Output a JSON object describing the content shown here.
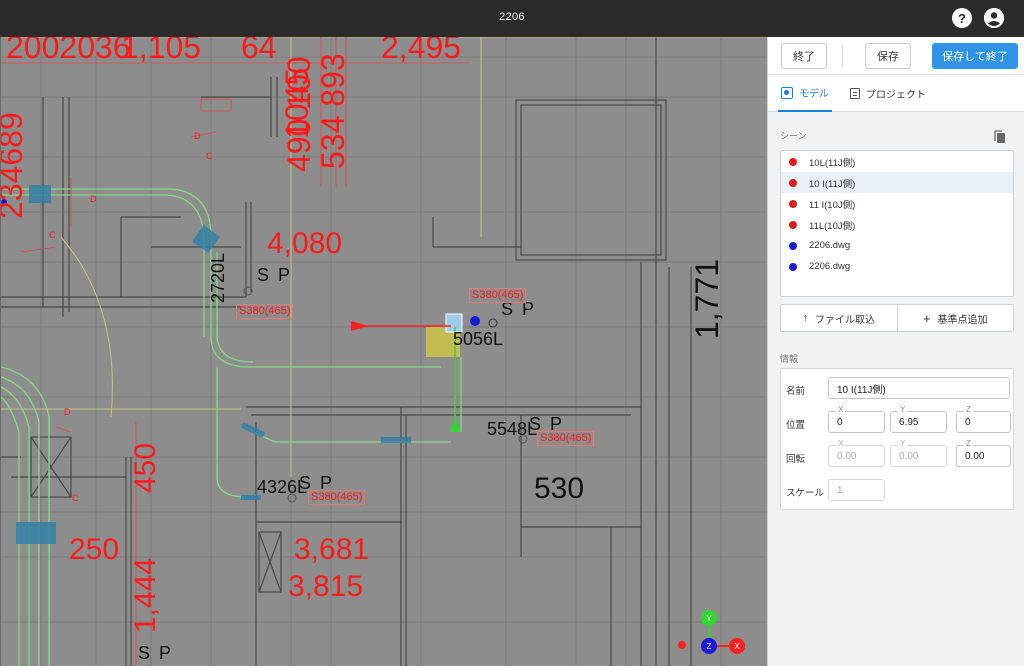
{
  "window": {
    "title": "2206"
  },
  "header": {
    "help_icon": "help-circle-icon",
    "account_icon": "account-circle-icon"
  },
  "toolbar": {
    "exit_label": "終了",
    "save_label": "保存",
    "save_exit_label": "保存して終了"
  },
  "tabs": [
    {
      "label": "モデル",
      "icon": "model-icon",
      "active": true
    },
    {
      "label": "プロジェクト",
      "icon": "document-icon",
      "active": false
    }
  ],
  "scene": {
    "label": "シーン",
    "copy_icon": "copy-icon",
    "items": [
      {
        "label": "10L(11J側)",
        "color": "#e01b1b",
        "selected": false
      },
      {
        "label": "10 I(11J側)",
        "color": "#e01b1b",
        "selected": true
      },
      {
        "label": "11 I(10J側)",
        "color": "#e01b1b",
        "selected": false
      },
      {
        "label": "11L(10J側)",
        "color": "#e01b1b",
        "selected": false
      },
      {
        "label": "2206.dwg",
        "color": "#1a1ad8",
        "selected": false
      },
      {
        "label": "2206.dwg",
        "color": "#1a1ad8",
        "selected": false
      }
    ]
  },
  "actions": {
    "import_label": "ファイル取込",
    "add_ref_label": "基準点追加"
  },
  "info": {
    "label": "情報",
    "name_label": "名前",
    "name_value": "10 I(11J側)",
    "position_label": "位置",
    "position": {
      "x": "0",
      "y": "6.95",
      "z": "0"
    },
    "rotation_label": "回転",
    "rotation": {
      "x": "0.00",
      "y": "0.00",
      "z": "0.00"
    },
    "scale_label": "スケール",
    "scale_value": "1",
    "axis": {
      "x": "X",
      "y": "Y",
      "z": "Z"
    }
  },
  "viewport": {
    "dimensions": [
      "2002036",
      "1,105",
      "64",
      "2,495",
      "1045",
      "490 100",
      "534 893",
      "234689",
      "4,080",
      "1,771",
      "450",
      "250",
      "530",
      "1,444",
      "3,681",
      "3,815"
    ],
    "labels": [
      "2720L",
      "S P",
      "5056L",
      "5548L",
      "4326L",
      "S P",
      "S P",
      "S P",
      "S P"
    ],
    "tags": [
      "S380(465)",
      "S380(465)",
      "S380(465)",
      "S380(465)"
    ],
    "marks": [
      "D",
      "C",
      "D",
      "C",
      "D",
      "C"
    ],
    "gizmo": {
      "y": "Y",
      "z": "Z",
      "x": "X"
    }
  },
  "colors": {
    "accent": "#2f93e6",
    "topbar": "#2b2b2d",
    "dim_red": "#ff1a1a"
  }
}
